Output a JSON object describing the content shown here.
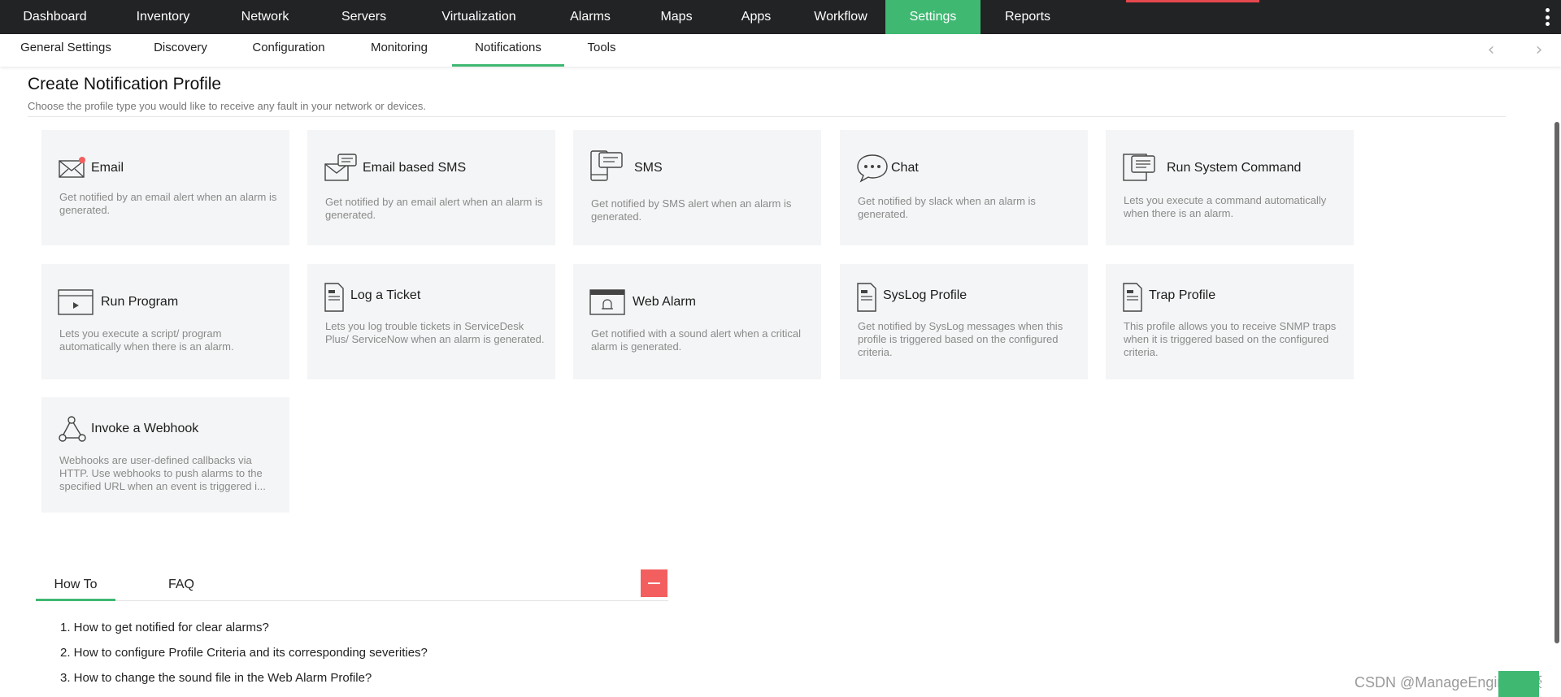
{
  "top_nav": {
    "items": [
      {
        "label": "Dashboard",
        "active": false
      },
      {
        "label": "Inventory",
        "active": false
      },
      {
        "label": "Network",
        "active": false
      },
      {
        "label": "Servers",
        "active": false
      },
      {
        "label": "Virtualization",
        "active": false
      },
      {
        "label": "Alarms",
        "active": false
      },
      {
        "label": "Maps",
        "active": false
      },
      {
        "label": "Apps",
        "active": false
      },
      {
        "label": "Workflow",
        "active": false
      },
      {
        "label": "Settings",
        "active": true
      },
      {
        "label": "Reports",
        "active": false
      }
    ],
    "menu_icon": "more-vertical-icon"
  },
  "sub_nav": {
    "items": [
      {
        "label": "General Settings",
        "active": false
      },
      {
        "label": "Discovery",
        "active": false
      },
      {
        "label": "Configuration",
        "active": false
      },
      {
        "label": "Monitoring",
        "active": false
      },
      {
        "label": "Notifications",
        "active": true
      },
      {
        "label": "Tools",
        "active": false
      }
    ],
    "prev_icon": "chevron-left-icon",
    "next_icon": "chevron-right-icon"
  },
  "page": {
    "title": "Create Notification Profile",
    "subtitle": "Choose the profile type you would like to receive any fault in your network or devices."
  },
  "profiles": [
    {
      "title": "Email",
      "description": "Get notified by an email alert when an alarm is generated.",
      "icon": "email-icon"
    },
    {
      "title": "Email based SMS",
      "description": "Get notified by an email alert when an alarm is generated.",
      "icon": "email-sms-icon"
    },
    {
      "title": "SMS",
      "description": "Get notified by SMS alert when an alarm is generated.",
      "icon": "sms-icon"
    },
    {
      "title": "Chat",
      "description": "Get notified by slack when an alarm is generated.",
      "icon": "chat-icon"
    },
    {
      "title": "Run System Command",
      "description": "Lets you execute a command automatically when there is an alarm.",
      "icon": "system-command-icon"
    },
    {
      "title": "Run Program",
      "description": "Lets you execute a script/ program automatically when there is an alarm.",
      "icon": "run-program-icon"
    },
    {
      "title": "Log a Ticket",
      "description": "Lets you log trouble tickets in ServiceDesk Plus/ ServiceNow when an alarm is generated.",
      "icon": "ticket-icon"
    },
    {
      "title": "Web Alarm",
      "description": "Get notified with a sound alert when a critical alarm is generated.",
      "icon": "web-alarm-icon"
    },
    {
      "title": "SysLog Profile",
      "description": "Get notified by SysLog messages when this profile is triggered based on the configured criteria.",
      "icon": "syslog-icon"
    },
    {
      "title": "Trap Profile",
      "description": "This profile allows you to receive SNMP traps when it is triggered based on the configured criteria.",
      "icon": "trap-icon"
    },
    {
      "title": "Invoke a Webhook",
      "description": "Webhooks are user-defined callbacks via HTTP. Use webhooks to push alarms to the specified URL when an event is triggered i...",
      "icon": "webhook-icon"
    }
  ],
  "help": {
    "tabs": [
      {
        "label": "How To",
        "active": true
      },
      {
        "label": "FAQ",
        "active": false
      }
    ],
    "collapse_icon": "minus-icon",
    "items": [
      "1. How to get notified for clear alarms?",
      "2. How to configure Profile Criteria and its corresponding severities?",
      "3. How to change the sound file in the Web Alarm Profile?"
    ]
  },
  "watermark": "CSDN @ManageEngine卓豪",
  "colors": {
    "accent": "#3fb872",
    "topbar": "#222325",
    "card_bg": "#f4f5f6",
    "collapse": "#f35f5f"
  }
}
